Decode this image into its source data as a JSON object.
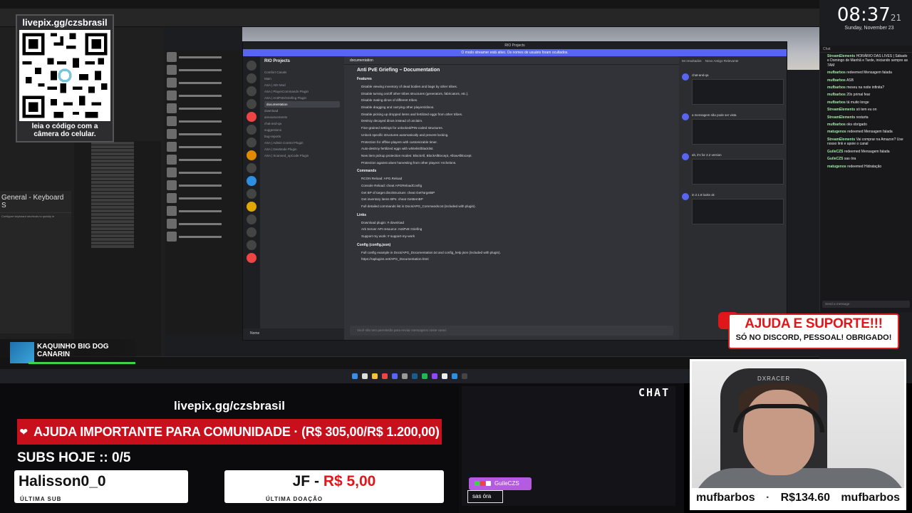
{
  "colors": {
    "goal_red": "#c8101d",
    "help_red": "#e0161b",
    "discord_blurple": "#5865f2",
    "chat_purple": "#b45be0",
    "donation_red": "#e0161b"
  },
  "qr_panel": {
    "title": "livepix.gg/czsbrasil",
    "caption_line1": "leia o código com a",
    "caption_line2": "câmera do celular."
  },
  "clock": {
    "time": "08:37",
    "seconds": "21",
    "date": "Sunday, November 23"
  },
  "editor": {
    "panel_title": "General - Keyboard S",
    "panel_subtitle": "Configure keyboard shortcuts to quickly in"
  },
  "discord": {
    "window_title": "RIO Projects",
    "notice": "O modo streamer está ativo. Os nomes de usuário foram ocultados.",
    "server_name": "RIO Projects",
    "channels": [
      "Comfort Canals",
      "Main",
      "ASA | ADI Mod",
      "ASA | PlayerCommands Plugin",
      "ASA | AntiPvE/Griefing Plugin",
      "documentation",
      "download",
      "announcements",
      "chat-and-qa",
      "suggestions",
      "bug-reports",
      "ASA | Admin Control Plugin",
      "ASA | DevMode Plugin",
      "ASA | Scanned_opCode Plugin"
    ],
    "active_channel": "documentation",
    "channel_header": "documentation",
    "post_title": "Anti PvE Griefing – Documentation",
    "features_heading": "Features",
    "features": [
      "Disable viewing inventory of dead bodies and bags by other tribes.",
      "Disable turning on/off other tribes structures (generators, fabricators, etc.).",
      "Disable mating dinos of different tribes.",
      "Disable dragging and carrying other players/dinos.",
      "Disable picking up dropped items and fertilized eggs from other tribes.",
      "Destroy decayed dinos instead of unclaim.",
      "Fine-grained settings for unlocked/PIN-coded structures.",
      "Unlock specific structures automatically and prevent locking.",
      "Protection for offline players with customizable timer.",
      "Auto-destroy fertilized eggs with whitelist/blacklist.",
      "New item pickup protection modes: BlockAll, BlockAllExcept, AllowAllExcept.",
      "Protection against aloes harvesting from other players' Archelons."
    ],
    "commands_heading": "Commands",
    "commands": [
      "RCON Reload: APG.Reload",
      "Console Reload: cheat APGReloadConfig",
      "Get BP of target dino/structure: cheat GetTargetBP",
      "Get inventory items BPs: cheat GetItemBP",
      "Full detailed commands list in Docs/APG_Commands.txt (included with plugin)."
    ],
    "links_heading": "Links",
    "links": [
      "Download plugin: # download",
      "Ark Server API resource: AntiPvE Griefing",
      "Support my work: # support-my-work"
    ],
    "config_heading": "Config (config.json)",
    "config_lines": [
      "Full config example in Docs/APG_Documentation.txt and config_help.json (included with plugin).",
      "https://raplugins.net/APG_Documentation.html"
    ],
    "input_placeholder": "Você não tem permissão para enviar mensagens neste canal.",
    "search_header": "94 resultados",
    "search_tabs": [
      "Novo",
      "Antigo",
      "Relevante"
    ],
    "results": [
      "chat-and-qa",
      "a mensagem não pode ser vista",
      "ah, it's for 2.2 version",
      "in 2.1.8 looks ok"
    ],
    "user_name": "Nome"
  },
  "twitch_chat": {
    "header": "Chat",
    "messages": [
      {
        "user": "StreamElements",
        "text": "HORÁRIO DAS LIVES | Sábado e Domingo de Manhã e Tarde, iniciando sempre as 7AM"
      },
      {
        "user": "mufbarbos",
        "text": "redeemed Mensagem falada"
      },
      {
        "user": "mufbarbos",
        "text": "ASB"
      },
      {
        "user": "mufbarbos",
        "text": "mexeu na noite infinita?"
      },
      {
        "user": "mufbarbos",
        "text": "20x primal fear"
      },
      {
        "user": "mufbarbos",
        "text": "tá muito longe"
      },
      {
        "user": "StreamElements",
        "text": "só tem eu on"
      },
      {
        "user": "StreamElements",
        "text": "restarta"
      },
      {
        "user": "mufbarbos",
        "text": "oks obrigado"
      },
      {
        "user": "matugenos",
        "text": "redeemed Mensagem falada"
      },
      {
        "user": "StreamElements",
        "text": "Vai comprar na Amazon? Use nosso link e apoie o canal"
      },
      {
        "user": "GuileCZS",
        "text": "redeemed Mensagem falada"
      },
      {
        "user": "GuileCZS",
        "text": "sas óra"
      },
      {
        "user": "matugenos",
        "text": "redeemed Hidratação"
      }
    ],
    "input_placeholder": "Send a message"
  },
  "help_overlay": {
    "title": "AJUDA E SUPORTE!!!",
    "subtitle": "SÓ NO DISCORD, PESSOAL! OBRIGADO!"
  },
  "sub_alert": {
    "line1": "KAQUINHO BIG DOG",
    "line2": "CANARIN"
  },
  "bottom": {
    "livepix_url": "livepix.gg/czsbrasil",
    "goal_text": "AJUDA IMPORTANTE PARA COMUNIDADE",
    "goal_separator": "·",
    "goal_amount": "(R$ 305,00/R$ 1.200,00)",
    "subs_today": "SUBS HOJE :: 0/5",
    "last_sub_name": "Halisson0_0",
    "last_sub_label": "ÚLTIMA SUB",
    "last_donation_name": "JF",
    "last_donation_separator": " - ",
    "last_donation_amount": "R$ 5,00",
    "last_donation_label": "ÚLTIMA DOAÇÃO"
  },
  "chat_overlay": {
    "label": "CHAT",
    "bubble_user": "GuileCZS",
    "bubble_message": "sas óra"
  },
  "webcam": {
    "chair_brand": "DXRACER",
    "footer_user": "mufbarbos",
    "footer_separator": "·",
    "footer_amount": "R$134.60",
    "footer_user2": "mufbarbos"
  }
}
